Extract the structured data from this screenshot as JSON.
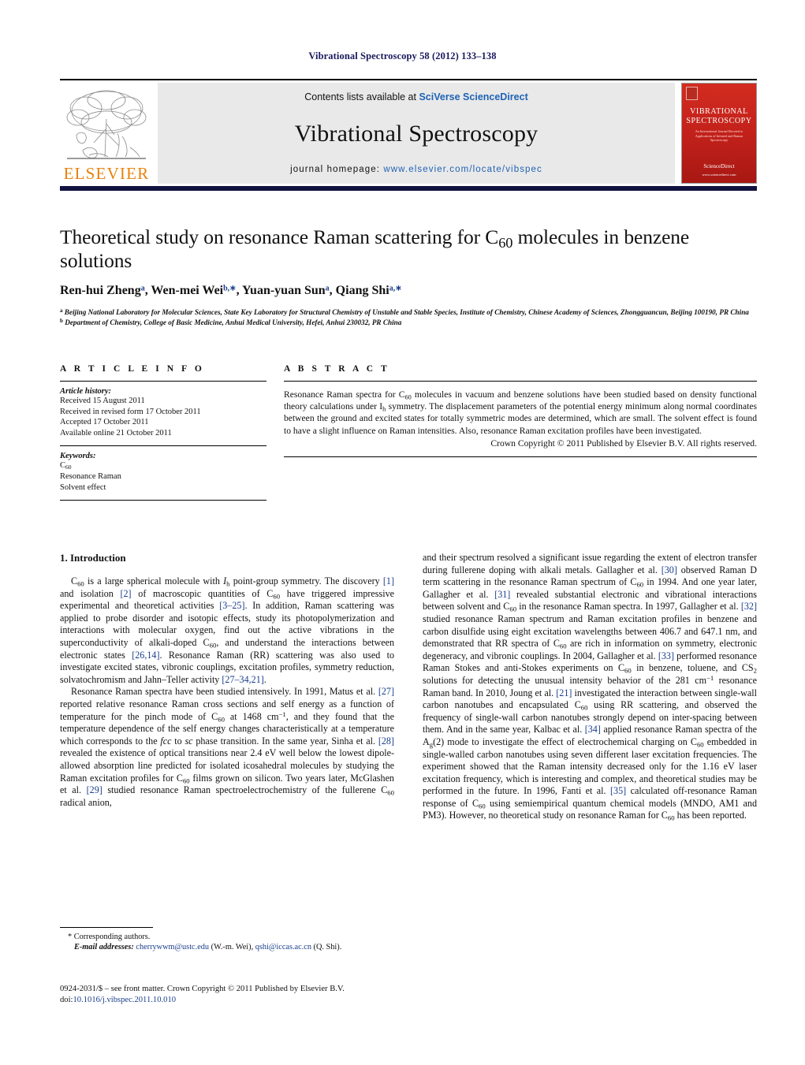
{
  "running_head": "Vibrational Spectroscopy 58 (2012) 133–138",
  "masthead": {
    "contents_prefix": "Contents lists available at ",
    "contents_link": "SciVerse ScienceDirect",
    "journal_name": "Vibrational Spectroscopy",
    "homepage_prefix": "journal homepage: ",
    "homepage_url": "www.elsevier.com/locate/vibspec",
    "publisher": "ELSEVIER",
    "cover": {
      "title_line1": "VIBRATIONAL",
      "title_line2": "SPECTROSCOPY",
      "subtitle": "An International Journal Devoted to Applications of Infrared and Raman Spectroscopy",
      "footer_line1": "Available online at",
      "footer_line2": "ScienceDirect",
      "footer_line3": "www.sciencedirect.com"
    }
  },
  "title": "Theoretical study on resonance Raman scattering for C60 molecules in benzene solutions",
  "authors_html": "Ren-hui Zheng<sup>a</sup>, Wen-mei Wei<sup>b,∗</sup>, Yuan-yuan Sun<sup>a</sup>, Qiang Shi<sup>a,∗</sup>",
  "affiliations": [
    "a Beijing National Laboratory for Molecular Sciences, State Key Laboratory for Structural Chemistry of Unstable and Stable Species, Institute of Chemistry, Chinese Academy of Sciences, Zhongguancun, Beijing 100190, PR China",
    "b Department of Chemistry, College of Basic Medicine, Anhui Medical University, Hefei, Anhui 230032, PR China"
  ],
  "article_info": {
    "heading": "A R T I C L E  I N F O",
    "history_label": "Article history:",
    "history": [
      "Received 15 August 2011",
      "Received in revised form 17 October 2011",
      "Accepted 17 October 2011",
      "Available online 21 October 2011"
    ],
    "keywords_label": "Keywords:",
    "keywords": [
      "C60",
      "Resonance Raman",
      "Solvent effect"
    ]
  },
  "abstract": {
    "heading": "A B S T R A C T",
    "text": "Resonance Raman spectra for C60 molecules in vacuum and benzene solutions have been studied based on density functional theory calculations under Ih symmetry. The displacement parameters of the potential energy minimum along normal coordinates between the ground and excited states for totally symmetric modes are determined, which are small. The solvent effect is found to have a slight influence on Raman intensities. Also, resonance Raman excitation profiles have been investigated.",
    "copyright": "Crown Copyright © 2011 Published by Elsevier B.V. All rights reserved."
  },
  "section": {
    "number_title": "1.  Introduction"
  },
  "body": {
    "left_paragraphs": [
      "C60 is a large spherical molecule with Ih point-group symmetry. The discovery [1] and isolation [2] of macroscopic quantities of C60 have triggered impressive experimental and theoretical activities [3–25]. In addition, Raman scattering was applied to probe disorder and isotopic effects, study its photopolymerization and interactions with molecular oxygen, find out the active vibrations in the superconductivity of alkali-doped C60, and understand the interactions between electronic states [26,14]. Resonance Raman (RR) scattering was also used to investigate excited states, vibronic couplings, excitation profiles, symmetry reduction, solvatochromism and Jahn–Teller activity [27–34,21].",
      "Resonance Raman spectra have been studied intensively. In 1991, Matus et al. [27] reported relative resonance Raman cross sections and self energy as a function of temperature for the pinch mode of C60 at 1468 cm−1, and they found that the temperature dependence of the self energy changes characteristically at a temperature which corresponds to the fcc to sc phase transition. In the same year, Sinha et al. [28] revealed the existence of optical transitions near 2.4 eV well below the lowest dipole-allowed absorption line predicted for isolated icosahedral molecules by studying the Raman excitation profiles for C60 films grown on silicon. Two years later, McGlashen et al. [29] studied resonance Raman spectroelectrochemistry of the fullerene C60 radical anion,"
    ],
    "right_paragraphs": [
      "and their spectrum resolved a significant issue regarding the extent of electron transfer during fullerene doping with alkali metals. Gallagher et al. [30] observed Raman D term scattering in the resonance Raman spectrum of C60 in 1994. And one year later, Gallagher et al. [31] revealed substantial electronic and vibrational interactions between solvent and C60 in the resonance Raman spectra. In 1997, Gallagher et al. [32] studied resonance Raman spectrum and Raman excitation profiles in benzene and carbon disulfide using eight excitation wavelengths between 406.7 and 647.1 nm, and demonstrated that RR spectra of C60 are rich in information on symmetry, electronic degeneracy, and vibronic couplings. In 2004, Gallagher et al. [33] performed resonance Raman Stokes and anti-Stokes experiments on C60 in benzene, toluene, and CS2 solutions for detecting the unusual intensity behavior of the 281 cm−1 resonance Raman band. In 2010, Joung et al. [21] investigated the interaction between single-wall carbon nanotubes and encapsulated C60 using RR scattering, and observed the frequency of single-wall carbon nanotubes strongly depend on inter-spacing between them. And in the same year, Kalbac et al. [34] applied resonance Raman spectra of the Ag(2) mode to investigate the effect of electrochemical charging on C60 embedded in single-walled carbon nanotubes using seven different laser excitation frequencies. The experiment showed that the Raman intensity decreased only for the 1.16 eV laser excitation frequency, which is interesting and complex, and theoretical studies may be performed in the future. In 1996, Fanti et al. [35] calculated off-resonance Raman response of C60 using semiempirical quantum chemical models (MNDO, AM1 and PM3). However, no theoretical study on resonance Raman for C60 has been reported."
    ]
  },
  "footnotes": {
    "corresponding": "* Corresponding authors.",
    "email_label": "E-mail addresses:",
    "email1": "cherrywwm@ustc.edu",
    "email1_owner": "(W.-m. Wei)",
    "email2": "qshi@iccas.ac.cn",
    "email2_owner": "(Q. Shi)."
  },
  "imprint": {
    "line1": "0924-2031/$ – see front matter. Crown Copyright © 2011 Published by Elsevier B.V.",
    "doi_label": "doi:",
    "doi_value": "10.1016/j.vibspec.2011.10.010"
  },
  "colors": {
    "link_blue": "#1f62b5",
    "ref_blue": "#1a3e8c",
    "running_head_navy": "#1a1a5e",
    "rule_navy": "#12123f",
    "elsevier_orange": "#E8820B",
    "cover_red": "#c0201a",
    "masthead_grey": "#e9e9e9"
  }
}
